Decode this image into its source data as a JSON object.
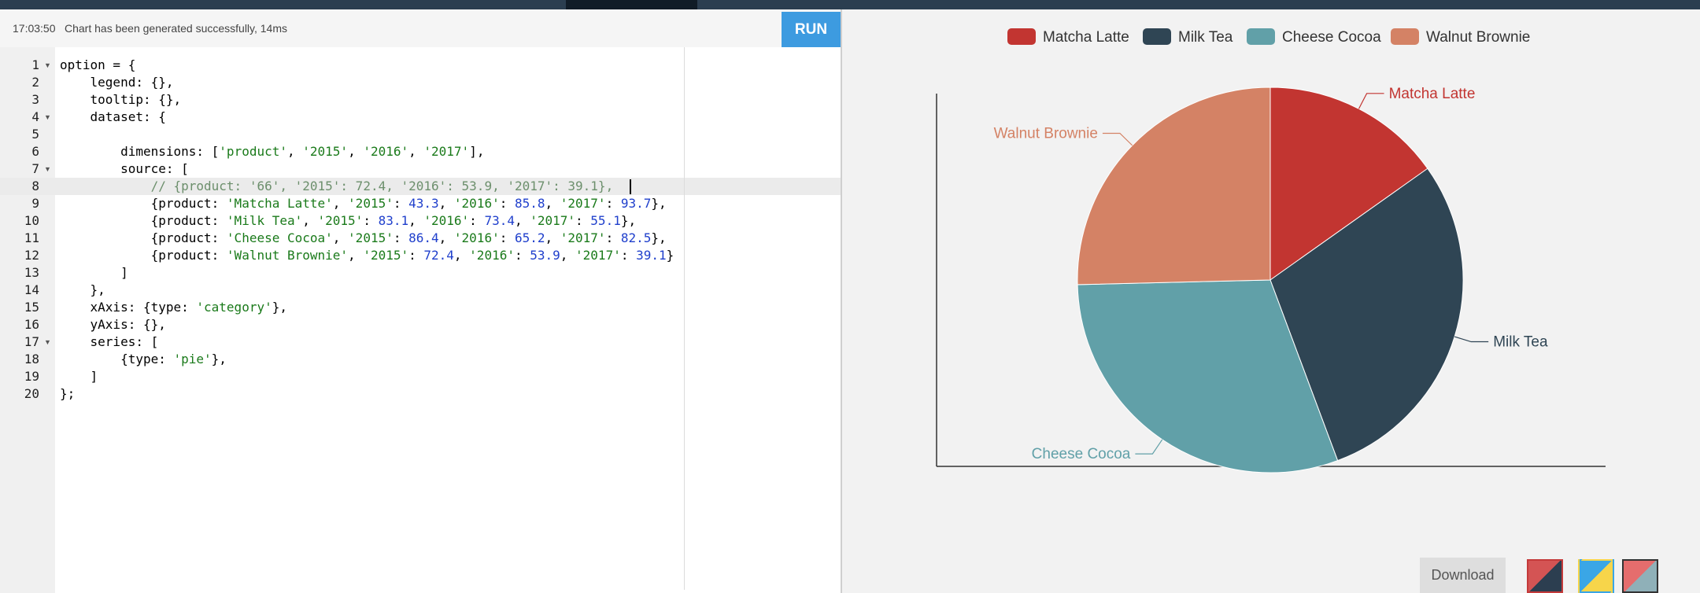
{
  "status": {
    "time": "17:03:50",
    "message": "Chart has been generated successfully, 14ms"
  },
  "toolbar": {
    "run_label": "RUN",
    "download_label": "Download"
  },
  "editor": {
    "active_line": 8,
    "lines": [
      {
        "n": "1",
        "fold": true,
        "text": "option = {"
      },
      {
        "n": "2",
        "fold": false,
        "text": "    legend: {},"
      },
      {
        "n": "3",
        "fold": false,
        "text": "    tooltip: {},"
      },
      {
        "n": "4",
        "fold": true,
        "text": "    dataset: {"
      },
      {
        "n": "5",
        "fold": false,
        "text": ""
      },
      {
        "n": "6",
        "fold": false,
        "text": "        dimensions: ['product', '2015', '2016', '2017'],"
      },
      {
        "n": "7",
        "fold": true,
        "text": "        source: ["
      },
      {
        "n": "8",
        "fold": false,
        "text": "            // {product: '66', '2015': 72.4, '2016': 53.9, '2017': 39.1},"
      },
      {
        "n": "9",
        "fold": false,
        "text": "            {product: 'Matcha Latte', '2015': 43.3, '2016': 85.8, '2017': 93.7},"
      },
      {
        "n": "10",
        "fold": false,
        "text": "            {product: 'Milk Tea', '2015': 83.1, '2016': 73.4, '2017': 55.1},"
      },
      {
        "n": "11",
        "fold": false,
        "text": "            {product: 'Cheese Cocoa', '2015': 86.4, '2016': 65.2, '2017': 82.5},"
      },
      {
        "n": "12",
        "fold": false,
        "text": "            {product: 'Walnut Brownie', '2015': 72.4, '2016': 53.9, '2017': 39.1}"
      },
      {
        "n": "13",
        "fold": false,
        "text": "        ]"
      },
      {
        "n": "14",
        "fold": false,
        "text": "    },"
      },
      {
        "n": "15",
        "fold": false,
        "text": "    xAxis: {type: 'category'},"
      },
      {
        "n": "16",
        "fold": false,
        "text": "    yAxis: {},"
      },
      {
        "n": "17",
        "fold": true,
        "text": "    series: ["
      },
      {
        "n": "18",
        "fold": false,
        "text": "        {type: 'pie'},"
      },
      {
        "n": "19",
        "fold": false,
        "text": "    ]"
      },
      {
        "n": "20",
        "fold": false,
        "text": "};"
      }
    ]
  },
  "chart_data": {
    "type": "pie",
    "legend": [
      "Matcha Latte",
      "Milk Tea",
      "Cheese Cocoa",
      "Walnut Brownie"
    ],
    "legend_position": "top",
    "slices": [
      {
        "name": "Matcha Latte",
        "value": 43.3,
        "color": "#c23531"
      },
      {
        "name": "Milk Tea",
        "value": 83.1,
        "color": "#2f4554"
      },
      {
        "name": "Cheese Cocoa",
        "value": 86.4,
        "color": "#61a0a8"
      },
      {
        "name": "Walnut Brownie",
        "value": 72.4,
        "color": "#d48265"
      }
    ],
    "axes_visible": true
  },
  "themes": [
    {
      "name": "default",
      "selected": true
    },
    {
      "name": "light",
      "selected": false
    },
    {
      "name": "dark",
      "selected": false
    }
  ]
}
